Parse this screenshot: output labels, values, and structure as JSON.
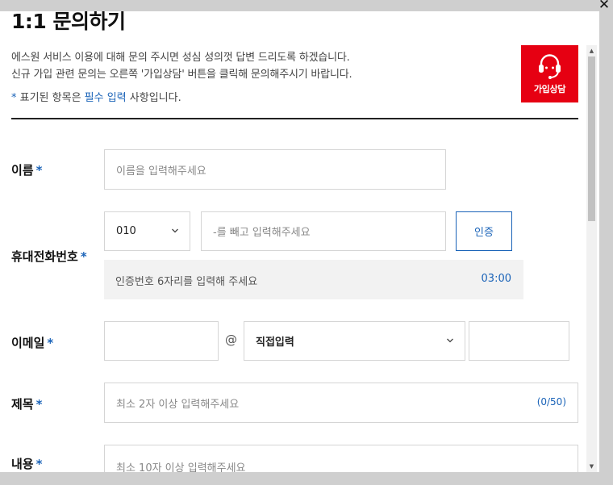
{
  "dialog": {
    "title": "1:1 문의하기",
    "close_label": "✕",
    "description_line1": "에스원 서비스 이용에 대해 문의 주시면 성심 성의껏 답변 드리도록 하겠습니다.",
    "description_line2": "신규 가입 관련 문의는 오른쪽 '가입상담' 버튼을 클릭해 문의해주시기 바랍니다.",
    "required_note": {
      "star": "*",
      "prefix": " 표기된 항목은 ",
      "emphasis": "필수 입력",
      "suffix": " 사항입니다."
    },
    "consult_button": {
      "label": "가입상담",
      "icon": "headset-icon",
      "color": "#e60012"
    }
  },
  "form": {
    "required_star": "*",
    "name": {
      "label": "이름",
      "placeholder": "이름을 입력해주세요"
    },
    "phone": {
      "label": "휴대전화번호",
      "prefix_value": "010",
      "placeholder": "-를 빼고 입력해주세요",
      "verify_button": "인증",
      "code_placeholder": "인증번호 6자리를 입력해 주세요",
      "timer": "03:00"
    },
    "email": {
      "label": "이메일",
      "id_value": "",
      "at_symbol": "@",
      "domain_select": "직접입력",
      "domain_value": ""
    },
    "subject": {
      "label": "제목",
      "placeholder": "최소 2자 이상 입력해주세요",
      "counter": "(0/50)"
    },
    "content": {
      "label": "내용",
      "placeholder": "최소 10자 이상 입력해주세요"
    }
  },
  "colors": {
    "accent": "#1a63b8",
    "brand_red": "#e60012",
    "overlay": "#cfcfcf"
  }
}
